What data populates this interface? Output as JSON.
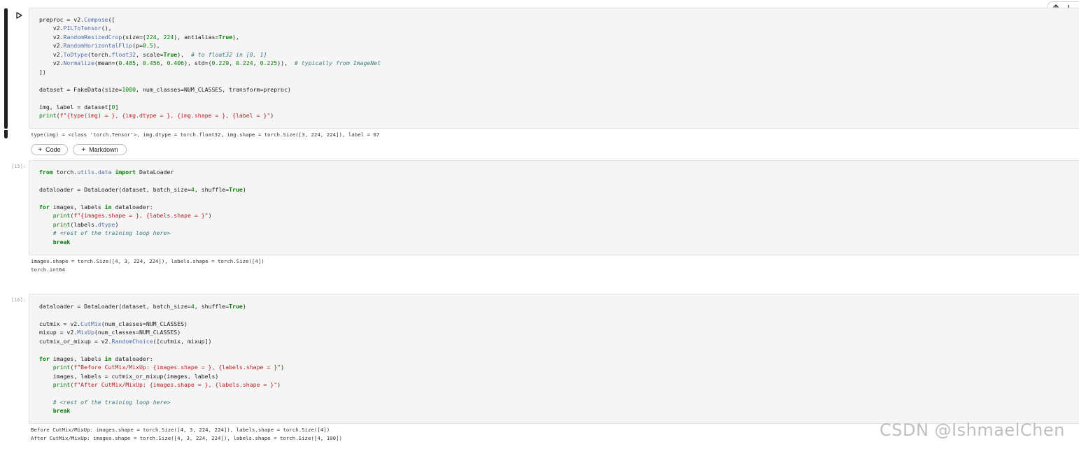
{
  "toolbar": {
    "move_up_icon": "arrow-up-icon",
    "move_down_icon": "arrow-down-icon"
  },
  "cell1": {
    "run_icon": "play-icon",
    "output": "type(img) = <class 'torch.Tensor'>, img.dtype = torch.float32, img.shape = torch.Size([3, 224, 224]), label = 67",
    "lines": [
      "preproc = v2.Compose([",
      "    v2.PILToTensor(),",
      "    v2.RandomResizedCrop(size=(224, 224), antialias=True),",
      "    v2.RandomHorizontalFlip(p=0.5),",
      "    v2.ToDtype(torch.float32, scale=True),  # to float32 in [0, 1]",
      "    v2.Normalize(mean=(0.485, 0.456, 0.406), std=(0.229, 0.224, 0.225)),  # typically from ImageNet",
      "])",
      "",
      "dataset = FakeData(size=1000, num_classes=NUM_CLASSES, transform=preproc)",
      "",
      "img, label = dataset[0]",
      "print(f\"{type(img) = }, {img.dtype = }, {img.shape = }, {label = }\")"
    ]
  },
  "add_cell": {
    "code_label": "Code",
    "markdown_label": "Markdown"
  },
  "cell2": {
    "prompt": "[15]:",
    "output_lines": [
      "images.shape = torch.Size([4, 3, 224, 224]), labels.shape = torch.Size([4])",
      "torch.int64"
    ],
    "lines": [
      "from torch.utils.data import DataLoader",
      "",
      "dataloader = DataLoader(dataset, batch_size=4, shuffle=True)",
      "",
      "for images, labels in dataloader:",
      "    print(f\"{images.shape = }, {labels.shape = }\")",
      "    print(labels.dtype)",
      "    # <rest of the training loop here>",
      "    break"
    ]
  },
  "cell3": {
    "prompt": "[16]:",
    "output_lines": [
      "Before CutMix/MixUp: images.shape = torch.Size([4, 3, 224, 224]), labels.shape = torch.Size([4])",
      "After CutMix/MixUp: images.shape = torch.Size([4, 3, 224, 224]), labels.shape = torch.Size([4, 100])"
    ],
    "lines": [
      "dataloader = DataLoader(dataset, batch_size=4, shuffle=True)",
      "",
      "cutmix = v2.CutMix(num_classes=NUM_CLASSES)",
      "mixup = v2.MixUp(num_classes=NUM_CLASSES)",
      "cutmix_or_mixup = v2.RandomChoice([cutmix, mixup])",
      "",
      "for images, labels in dataloader:",
      "    print(f\"Before CutMix/MixUp: {images.shape = }, {labels.shape = }\")",
      "    images, labels = cutmix_or_mixup(images, labels)",
      "    print(f\"After CutMix/MixUp: {images.shape = }, {labels.shape = }\")",
      "",
      "    # <rest of the training loop here>",
      "    break"
    ]
  },
  "watermark": "CSDN @IshmaelChen"
}
